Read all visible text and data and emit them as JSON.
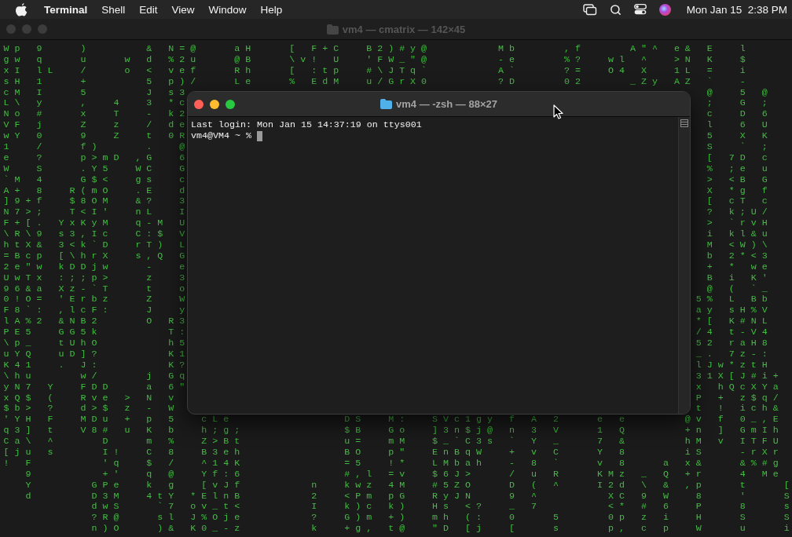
{
  "menu_bar": {
    "app_name": "Terminal",
    "menus": [
      "Shell",
      "Edit",
      "View",
      "Window",
      "Help"
    ],
    "clock": "Mon Jan 15  2:38 PM"
  },
  "back_window": {
    "title": "vm4 — cmatrix — 142×45",
    "active": false,
    "top_rows": [
      "W p   9       )           &   N = @       a H       [   F + C     B 2 ) # y @             M b         , f         A \" ^   e &   E     l",
      "g w   q       u       w   d   % 2 u       @ B       \\ v !   U     ' F W _ \" @             - e         % ?     w l   ^     > N   K     $",
      "x I   l L     /       o   <   v e f       R h       [   : t p     # \\ J T q `             A `         ? =     O 4   X     1 L   =     i",
      "s H   1       +           5   p ) /       L e       %   E d M     u / G r X 0             ? D         0 2         _ Z y   A Z   `     -"
    ],
    "split_rows": [
      {
        "left": "c M   I       5           J   s 3",
        "right": "  @     5   @"
      },
      {
        "left": "L \\   y       ,     4     3   * c",
        "right": "  ;     G   ;"
      },
      {
        "left": "N o   #       x     T     -   k 2",
        "right": "  c     D   6"
      },
      {
        "left": "V F   j       Z     z     /   d e",
        "right": "  l     6   U"
      },
      {
        "left": "w Y   0       9     Z     t   0 R",
        "right": "  5     X   K"
      },
      {
        "left": "1     /       f )         .     @",
        "right": "  S     `   ;"
      },
      {
        "left": "e     ?       p > m D   , G     6",
        "right": "  [   7 D   c"
      },
      {
        "left": "W     S       . Y 5     W C     G",
        "right": "  %   ; e   u"
      },
      {
        "left": "` M   4       G $ <     g s     c",
        "right": "  >   < B   G"
      },
      {
        "left": "A +   8     R ( m O     . E     d",
        "right": "  X   * g   f"
      },
      {
        "left": "] 9 + f     $ 8 O M     & ?     3",
        "right": "  [   c T   c"
      },
      {
        "left": "N 7 > ;     T < I '     n L     I",
        "right": "  ?   k ; U /"
      },
      {
        "left": "F + [ .   Y x K y M     q - M   U",
        "right": "  >   ` r v H"
      },
      {
        "left": "\\ R \\ 9   s 3 , I c     C : $   V",
        "right": "  i   k l & u"
      },
      {
        "left": "h t X &   3 < k ` D     r T )   L",
        "right": "  M   < W ) \\"
      },
      {
        "left": "= B c p   [ \\ h r X     s , Q   G",
        "right": "  b   2 * < 3"
      },
      {
        "left": "2 e \" w   k D D j w       -     e",
        "right": "  +   *   w e"
      },
      {
        "left": "U w T x   : ; ; p >       z     3",
        "right": "  B   i   K '"
      },
      {
        "left": "9 6 & a   X z - ` T       t     o",
        "right": "  @   (   ` _"
      },
      {
        "left": "0 ! O =   ' E r b z       Z     W",
        "right": "5 %   L   B b"
      },
      {
        "left": "F 8 ` :   , l c F :       J     y",
        "right": "a y   s H % V"
      },
      {
        "left": "l A % 2   & N B 2         O   R 3",
        "right": "* [   K # N L"
      },
      {
        "left": "P E 5     G G 5 k             T :",
        "right": "/ 4   t - V 4"
      },
      {
        "left": "\\ p _     t U h O             h 5",
        "right": "5 2   r a H 8"
      },
      {
        "left": "u Y Q     u D ] ?             K 1",
        "right": "_ .   7 z - :"
      },
      {
        "left": "K 4 1     .   J :             K ?",
        "right": "l J w * z t H"
      },
      {
        "left": "\\ h u         w /         j   G q",
        "right": "3 1 X [ J # i +"
      },
      {
        "left": "y N 7   Y     F D D       a   6 \"",
        "right": "x   h Q c X Y a"
      },
      {
        "left": "x Q $   (     R v e   >   N   v",
        "right": "P   +   z $ q /"
      },
      {
        "left": "$ b >   ?     d > $   z   -   W",
        "right": "t   !   i c h &"
      }
    ],
    "bottom_rows": [
      "' Y H   F     M D u   +   p   5     c L e                     D S     M :     S V c 1 g y   f   A   2       e   e           @ v   f   0 _ , E",
      "q 3 ]   t     V 8 #   u   K   b     h ; g ;                   $ B     G o     ] 3 n $ j @   n   3   V       1   Q           + n   ]   G m I h",
      "C a \\   ^         D       m   %     Z > B t                   u =     m M     $ _ ` C 3 s   `   Y   _       7   &           h M   v   I T F U",
      "[ j u   s         I !     C   8     B 3 e h                   B O     p \"     E n B q W     +   v   C       Y   8           i S       - r X r",
      "!   F             ' q     $   /     ^ 1 4 K                   = 5     ! *     L M b a h     -   8   `       v   8       a   x &       & % # g",
      "    9             + '     q   @     Y f : 6                   # , l   = v     $ 6 J >       /   u   R       K M z   _   Q   + r       4   M e",
      "    Y           G P e     k   g     [ v J f             n     k w z   4 M     # 5 Z O       D   (   ^       I 2 d   \\   &   , p       t       [",
      "    d           D 3 M     4 t Y   * E l n B             2     < P m   p G     R y J N       9   ^             X C   9   W     8       '       S",
      "                d w S       ` 7   o v _ t <             I     k ) c   k )     H s   < ?     _   7             < *   #   6     P       8       s",
      "                ? R @       s l   J % O j e             ?     G ) m   + )     m h   ( :     0       5         0 p   z   i     H       S       S",
      "                n ) O       ) &   K 0 _ - z             k     + g ,   t @     \" D   [ j     [       s         p ,   c   p     W       u       i"
    ]
  },
  "front_window": {
    "title": "vm4 — -zsh — 88×27",
    "active": true,
    "lines": [
      "Last login: Mon Jan 15 14:37:19 on ttys001",
      "vm4@VM4 ~ %"
    ]
  }
}
